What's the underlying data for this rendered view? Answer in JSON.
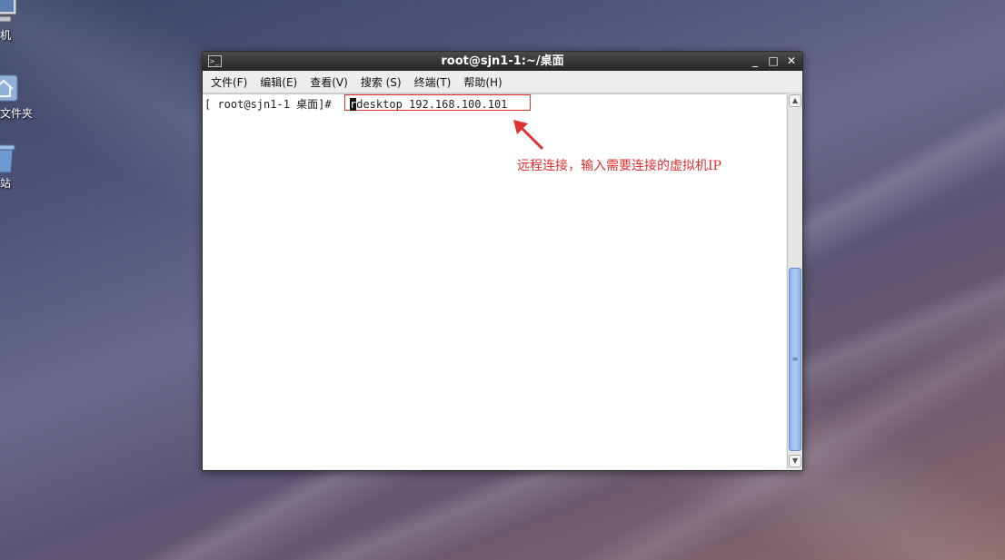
{
  "desktop": {
    "icons": [
      {
        "label": "算机",
        "icon": "computer-icon"
      },
      {
        "label": "主文件夹",
        "icon": "home-folder-icon"
      },
      {
        "label": "收站",
        "icon": "trash-icon"
      }
    ]
  },
  "window": {
    "title": "root@sjn1-1:~/桌面",
    "controls": {
      "minimize": "_",
      "maximize": "□",
      "close": "✕"
    },
    "menu": [
      "文件(F)",
      "编辑(E)",
      "查看(V)",
      "搜索 (S)",
      "终端(T)",
      "帮助(H)"
    ]
  },
  "terminal": {
    "prompt": "[ root@sjn1-1 桌面]#",
    "cursor_char": "r",
    "command_rest": "desktop 192.168.100.101"
  },
  "annotation": {
    "text": "远程连接，输入需要连接的虚拟机IP",
    "color": "#e03030"
  },
  "colors": {
    "titlebar": "#262626",
    "scrollbar_thumb": "#aecbf2"
  }
}
